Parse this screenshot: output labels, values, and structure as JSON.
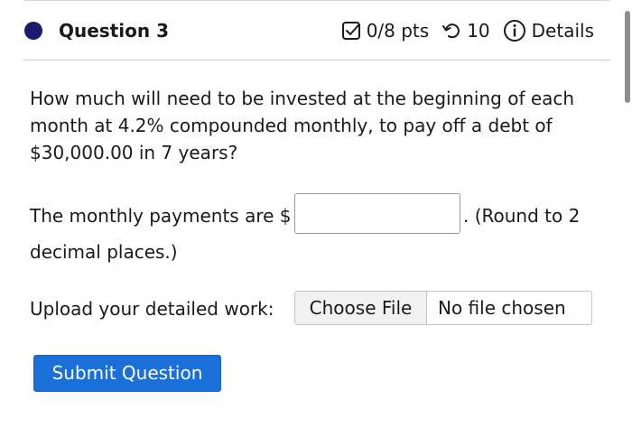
{
  "header": {
    "question_label": "Question 3",
    "points": "0/8 pts",
    "attempts": "10",
    "details_label": "Details",
    "status_color": "#1c1c6e"
  },
  "question": {
    "text": "How much will need to be invested at the beginning of each month at 4.2% compounded monthly, to pay off a debt of $30,000.00 in 7 years?",
    "answer_prefix": "The monthly payments are $",
    "answer_value": "",
    "answer_suffix_1": ". (Round to 2",
    "answer_suffix_2": "decimal places.)"
  },
  "upload": {
    "label": "Upload your detailed work:",
    "choose_button": "Choose File",
    "file_status": "No file chosen"
  },
  "submit": {
    "label": "Submit Question",
    "color": "#1b6fd8"
  },
  "icons": {
    "status": "status-dot-icon",
    "points": "checkbox-icon",
    "attempts": "retry-icon",
    "details": "info-icon"
  }
}
